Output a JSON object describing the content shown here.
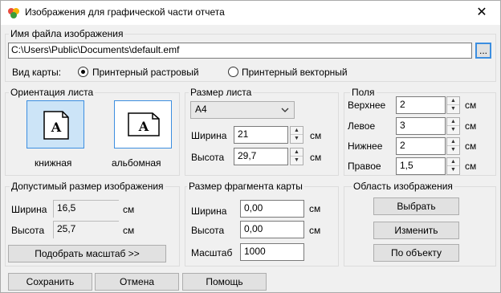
{
  "window": {
    "title": "Изображения для графической части отчета",
    "close_glyph": "✕"
  },
  "file": {
    "group_label": "Имя файла изображения",
    "path": "C:\\Users\\Public\\Documents\\default.emf",
    "browse_label": "..."
  },
  "map_type": {
    "label": "Вид карты:",
    "options": [
      "Принтерный растровый",
      "Принтерный векторный"
    ],
    "selected": "Принтерный растровый"
  },
  "orientation": {
    "group_label": "Ориентация листа",
    "portrait_label": "книжная",
    "landscape_label": "альбомная",
    "selected": "книжная",
    "icon_letter": "A"
  },
  "sheet": {
    "group_label": "Размер листа",
    "format": "A4",
    "width_label": "Ширина",
    "width": "21",
    "height_label": "Высота",
    "height": "29,7",
    "unit": "см"
  },
  "margins": {
    "group_label": "Поля",
    "top_label": "Верхнее",
    "top": "2",
    "left_label": "Левое",
    "left": "3",
    "bottom_label": "Нижнее",
    "bottom": "2",
    "right_label": "Правое",
    "right": "1,5",
    "unit": "см"
  },
  "allowed": {
    "group_label": "Допустимый размер изображения",
    "width_label": "Ширина",
    "width": "16,5",
    "height_label": "Высота",
    "height": "25,7",
    "unit": "см",
    "fit_button": "Подобрать масштаб >>"
  },
  "fragment": {
    "group_label": "Размер фрагмента карты",
    "width_label": "Ширина",
    "width": "0,00",
    "height_label": "Высота",
    "height": "0,00",
    "scale_label": "Масштаб",
    "scale": "1000",
    "unit": "см"
  },
  "area": {
    "group_label": "Область изображения",
    "select_button": "Выбрать",
    "change_button": "Изменить",
    "by_object_button": "По объекту"
  },
  "footer": {
    "save": "Сохранить",
    "cancel": "Отмена",
    "help": "Помощь"
  },
  "colors": {
    "selected_bg": "#cce4f7",
    "accent_border": "#3c8ee0"
  }
}
